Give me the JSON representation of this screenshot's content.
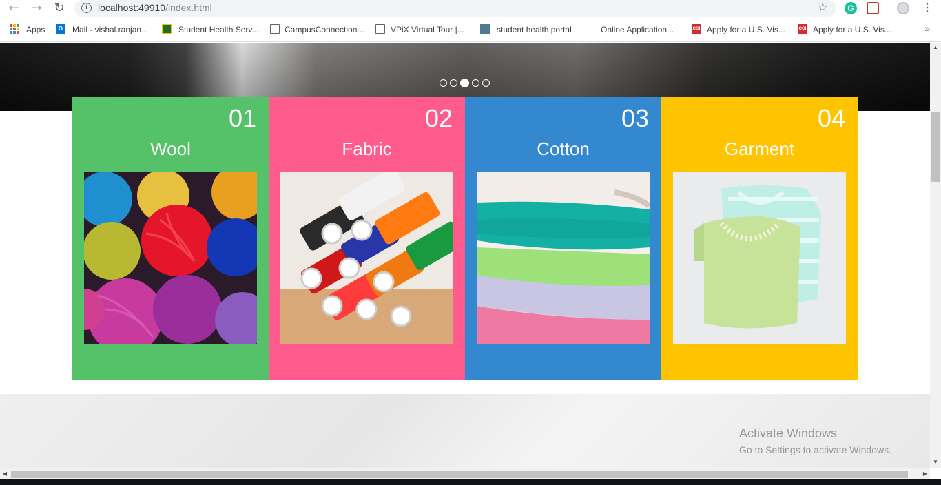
{
  "browser": {
    "url_host": "localhost:49910",
    "url_path": "/index.html",
    "bookmarks": [
      {
        "label": "Apps",
        "icon": "apps-grid-icon"
      },
      {
        "label": "Mail - vishal.ranjan...",
        "icon": "outlook-icon"
      },
      {
        "label": "Student Health Serv...",
        "icon": "site-favicon"
      },
      {
        "label": "CampusConnection...",
        "icon": "page-icon"
      },
      {
        "label": "VPiX Virtual Tour |...",
        "icon": "page-icon"
      },
      {
        "label": "student health portal",
        "icon": "people-icon"
      },
      {
        "label": "Online Application...",
        "icon": "none"
      },
      {
        "label": "Apply for a U.S. Vis...",
        "icon": "cgi-icon"
      },
      {
        "label": "Apply for a U.S. Vis...",
        "icon": "cgi-icon"
      }
    ],
    "more": "»"
  },
  "slider": {
    "dot_count": 5,
    "active_index": 2
  },
  "cards": [
    {
      "number": "01",
      "title": "Wool",
      "color": "#55c26a"
    },
    {
      "number": "02",
      "title": "Fabric",
      "color": "#ff5c8d"
    },
    {
      "number": "03",
      "title": "Cotton",
      "color": "#3388d0"
    },
    {
      "number": "04",
      "title": "Garment",
      "color": "#ffc400"
    }
  ],
  "watermark": {
    "line1": "Activate Windows",
    "line2": "Go to Settings to activate Windows."
  }
}
